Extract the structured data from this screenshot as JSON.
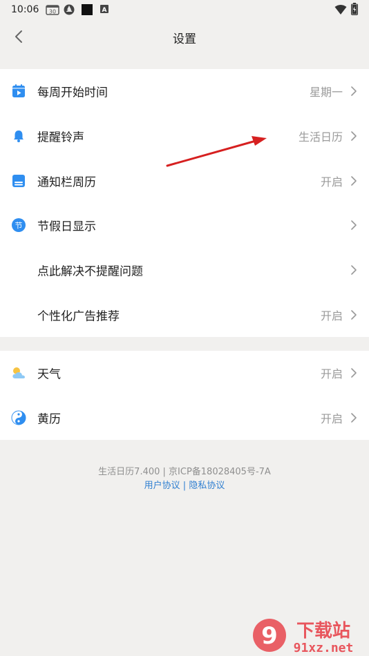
{
  "status_bar": {
    "time": "10:06",
    "calendar_date": "30",
    "badge_letter": "A"
  },
  "header": {
    "title": "设置"
  },
  "section1": [
    {
      "icon": "calendar-play-icon",
      "label": "每周开始时间",
      "value": "星期一"
    },
    {
      "icon": "bell-icon",
      "label": "提醒铃声",
      "value": "生活日历"
    },
    {
      "icon": "notification-calendar-icon",
      "label": "通知栏周历",
      "value": "开启"
    },
    {
      "icon": "holiday-jie-icon",
      "label": "节假日显示",
      "value": "",
      "icon_char": "节"
    },
    {
      "icon": "",
      "label": "点此解决不提醒问题",
      "value": ""
    },
    {
      "icon": "",
      "label": "个性化广告推荐",
      "value": "开启"
    }
  ],
  "section2": [
    {
      "icon": "weather-cloud-sun-icon",
      "label": "天气",
      "value": "开启"
    },
    {
      "icon": "yin-yang-icon",
      "label": "黄历",
      "value": "开启"
    }
  ],
  "footer": {
    "version_line": "生活日历7.400 | 京ICP备18028405号-7A",
    "user_agreement": "用户协议",
    "separator": "|",
    "privacy_agreement": "隐私协议"
  },
  "watermark": {
    "text_cn": "下载站",
    "text_url": "91xz.net",
    "logo_text": "9"
  },
  "colors": {
    "accent": "#2f8ef0",
    "link": "#2f7fd1",
    "annotation": "#d62020",
    "background": "#f1f0ee"
  }
}
